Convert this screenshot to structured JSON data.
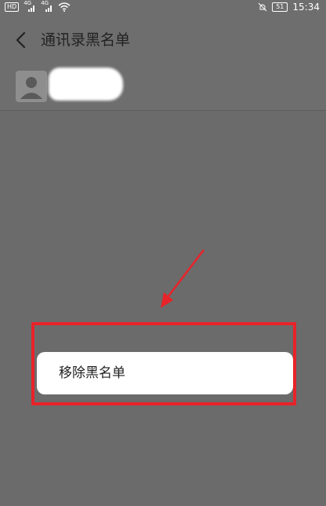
{
  "status_bar": {
    "hd_label": "HD",
    "sim1_label": "4G",
    "sim2_label": "4G",
    "battery_level": "51",
    "time": "15:34"
  },
  "header": {
    "title": "通讯录黑名单"
  },
  "contacts": [
    {
      "name": "",
      "redacted": true
    }
  ],
  "popup": {
    "remove_label": "移除黑名单"
  },
  "colors": {
    "highlight": "#e8232a",
    "dim_background": "#6b6b6b",
    "menu_background": "#ffffff"
  }
}
